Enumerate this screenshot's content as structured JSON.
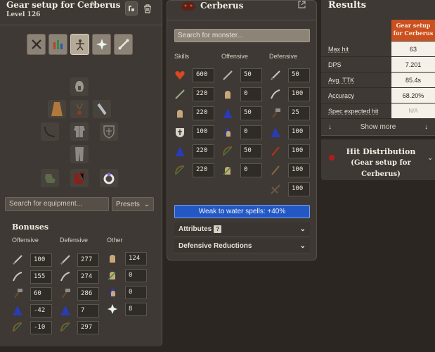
{
  "left": {
    "title": "Gear setup for Cerberus",
    "level": "Level 126",
    "search_placeholder": "Search for equipment...",
    "presets_label": "Presets",
    "bonuses_title": "Bonuses",
    "col_offensive": "Offensive",
    "col_defensive": "Defensive",
    "col_other": "Other",
    "offensive": [
      "100",
      "155",
      "60",
      "-42",
      "-10"
    ],
    "defensive": [
      "277",
      "274",
      "286",
      "7",
      "297"
    ],
    "other": [
      "124",
      "0",
      "0",
      "8"
    ]
  },
  "monster": {
    "name": "Cerberus",
    "search_placeholder": "Search for monster...",
    "col_skills": "Skills",
    "col_offensive": "Offensive",
    "col_defensive": "Defensive",
    "skills": [
      "600",
      "220",
      "220",
      "100",
      "220",
      "220"
    ],
    "offensive": [
      "50",
      "0",
      "50",
      "0",
      "50",
      "0"
    ],
    "defensive": [
      "50",
      "100",
      "25",
      "100",
      "100",
      "100",
      "100"
    ],
    "weakness": "Weak to water spells: +40%",
    "attributes_label": "Attributes",
    "defensive_reductions_label": "Defensive Reductions"
  },
  "results": {
    "title": "Results",
    "setup_header": "Gear setup for Cerberus",
    "rows": [
      {
        "label": "Max hit",
        "value": "63"
      },
      {
        "label": "DPS",
        "value": "7.201"
      },
      {
        "label": "Avg. TTK",
        "value": "85.4s"
      },
      {
        "label": "Accuracy",
        "value": "68.20%"
      },
      {
        "label": "Spec expected hit",
        "value": "N/A"
      }
    ],
    "show_more": "Show more",
    "hist_title": "Hit Distribution",
    "hist_sub": "(Gear setup for Cerberus)"
  },
  "colors": {
    "accent": "#cb5020",
    "weakness_bg": "#2358c4",
    "panel": "#3e3934"
  }
}
